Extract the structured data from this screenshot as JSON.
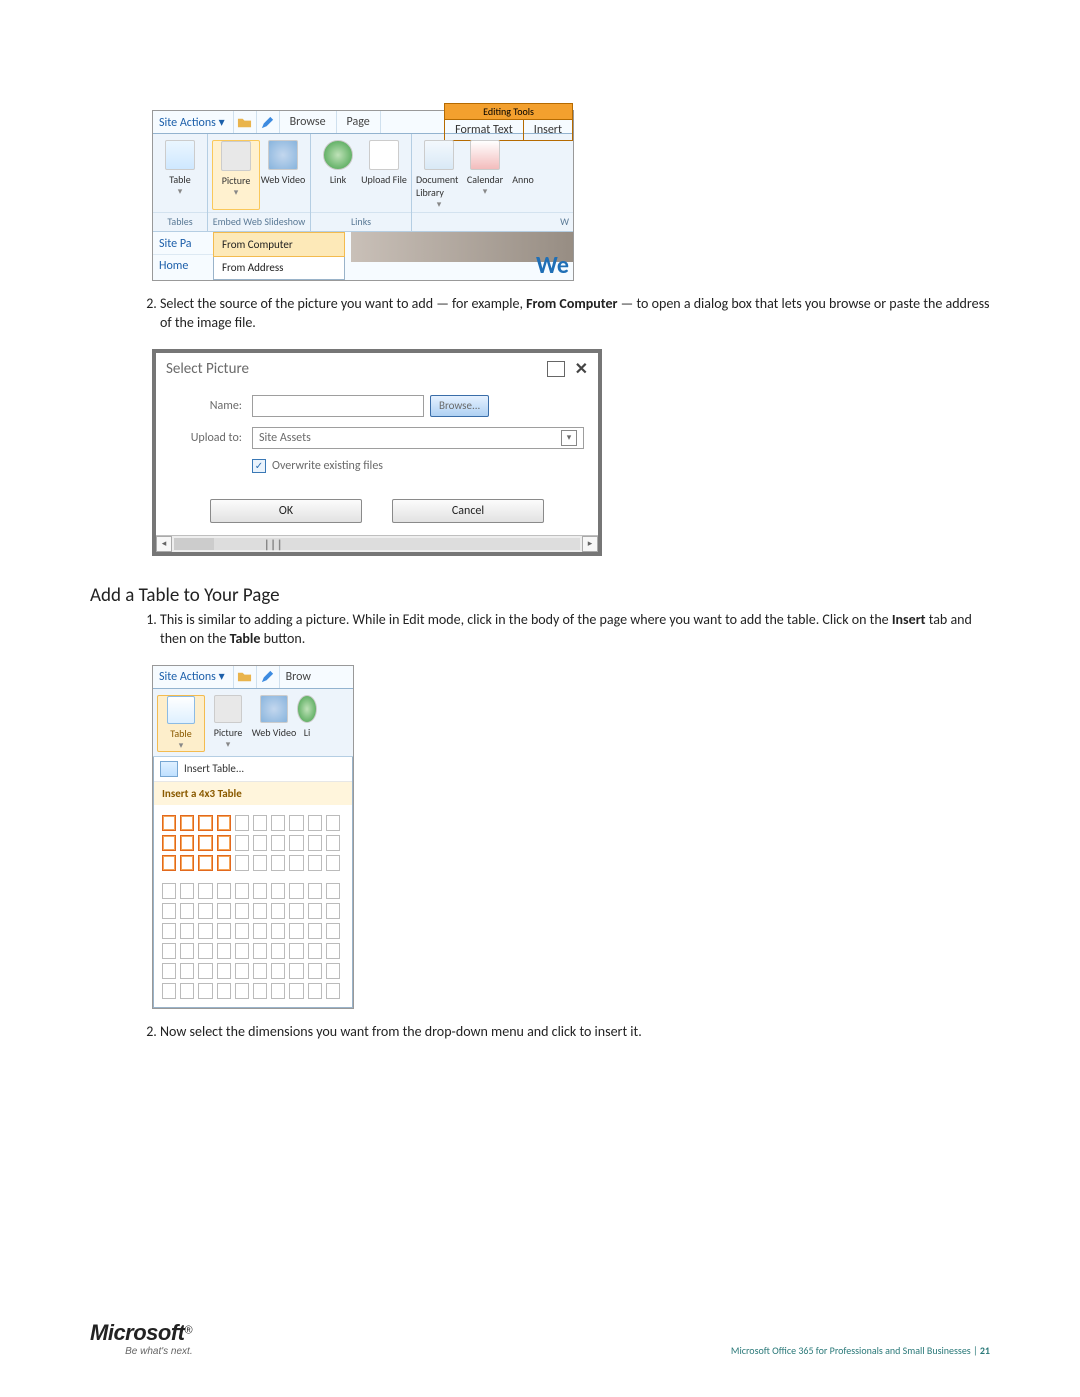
{
  "screenshot1": {
    "editingToolsLabel": "Editing Tools",
    "siteActions": "Site Actions ▾",
    "tabs": {
      "browse": "Browse",
      "page": "Page",
      "formatText": "Format Text",
      "insert": "Insert"
    },
    "groups": {
      "tables": "Tables",
      "embed": "Embed Web Slideshow",
      "links": "Links"
    },
    "buttons": {
      "table": "Table",
      "picture": "Picture",
      "webVideo": "Web Video",
      "link": "Link",
      "uploadFile": "Upload File",
      "documentLibrary": "Document Library",
      "calendar": "Calendar",
      "announcements": "Anno"
    },
    "picMenu": {
      "fromComputer": "From Computer",
      "fromAddress": "From Address"
    },
    "leftNav": {
      "sitePages": "Site Pa",
      "home": "Home"
    },
    "contentWord": "We",
    "trailingW": "W"
  },
  "step2a": {
    "num": "2.",
    "textBefore": "Select the source of the picture you want to add — for example, ",
    "bold": "From Computer",
    "textAfter": " — to open a dialog box that lets you browse or paste the address of the image file."
  },
  "dialog": {
    "title": "Select Picture",
    "nameLabel": "Name:",
    "browse": "Browse...",
    "uploadToLabel": "Upload to:",
    "uploadToValue": "Site Assets",
    "overwrite": "Overwrite existing files",
    "ok": "OK",
    "cancel": "Cancel"
  },
  "heading": "Add a Table to Your Page",
  "step1b": {
    "num": "1.",
    "textBefore": "This is similar to adding a picture. While in Edit mode, click in the body of the page where you want to add the table. Click on the ",
    "bold1": "Insert",
    "mid": " tab and then on the ",
    "bold2": "Table",
    "after": " button."
  },
  "screenshot2": {
    "siteActions": "Site Actions ▾",
    "browse": "Brow",
    "buttons": {
      "table": "Table",
      "picture": "Picture",
      "webVideo": "Web Video",
      "link": "Li"
    },
    "insertTable": "Insert Table...",
    "insert4x3": "Insert a 4x3 Table"
  },
  "step2b": {
    "num": "2.",
    "text": "Now select the dimensions you want from the drop-down menu and click to insert it."
  },
  "footer": {
    "logo": "Microsoft",
    "tag": "Be what's next.",
    "doc": "Microsoft Office 365 for Professionals and Small Businesses |",
    "page": " 21"
  }
}
